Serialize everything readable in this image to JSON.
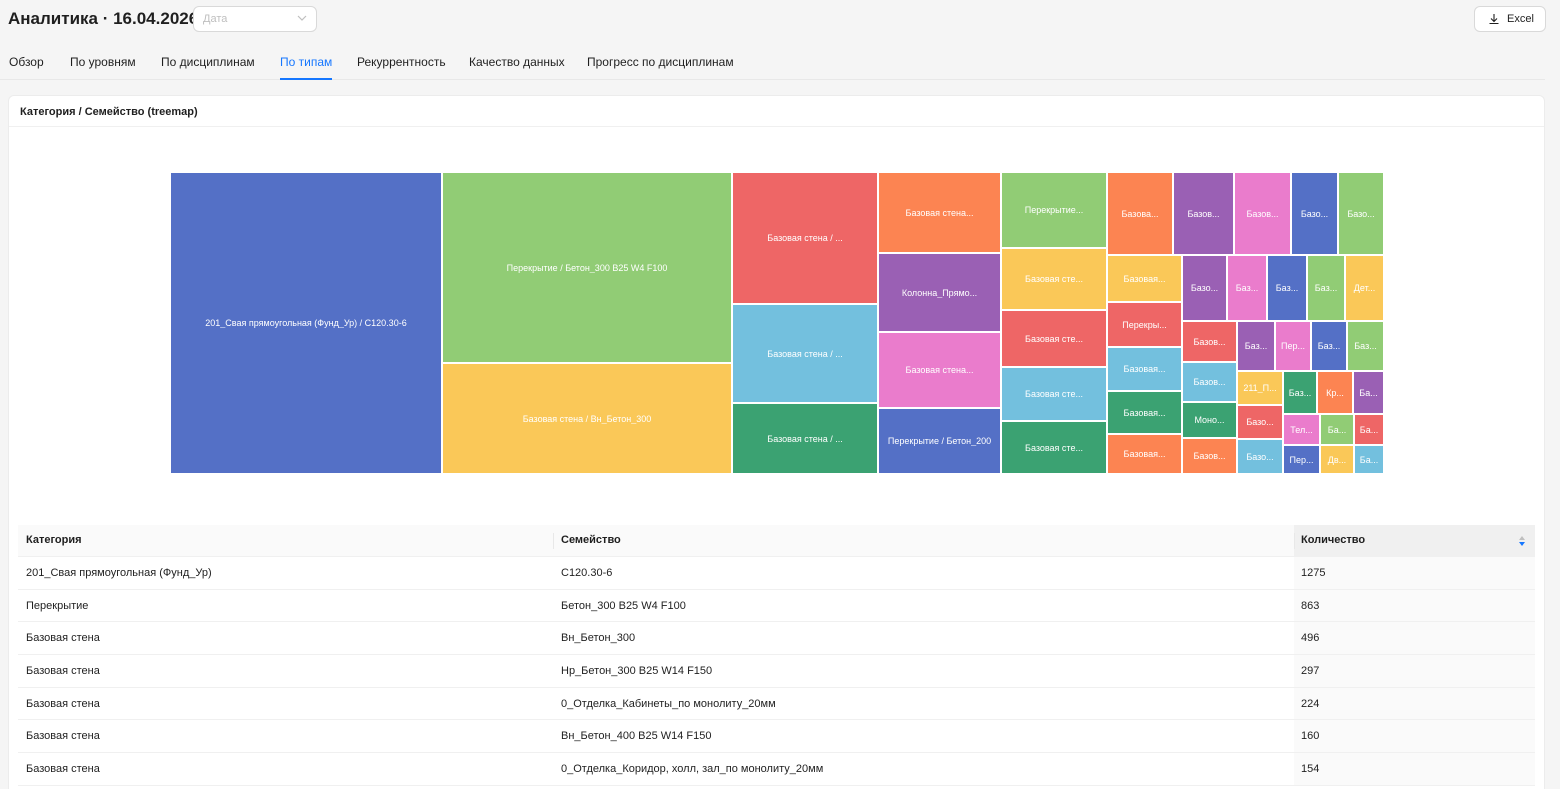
{
  "header": {
    "title": "Аналитика · 16.04.2026",
    "date_placeholder": "Дата",
    "export_label": "Excel"
  },
  "tabs": [
    {
      "label": "Обзор",
      "active": false
    },
    {
      "label": "По уровням",
      "active": false
    },
    {
      "label": "По дисциплинам",
      "active": false
    },
    {
      "label": "По типам",
      "active": true
    },
    {
      "label": "Рекуррентность",
      "active": false
    },
    {
      "label": "Качество данных",
      "active": false
    },
    {
      "label": "Прогресс по дисциплинам",
      "active": false
    }
  ],
  "card": {
    "title": "Категория / Семейство (treemap)"
  },
  "treemap": {
    "tiles": [
      {
        "label": "201_Свая прямоугольная (Фунд_Ур) / С120.30-6",
        "color": "#5470c6"
      },
      {
        "label": "Перекрытие / Бетон_300 B25 W4 F100",
        "color": "#91cc75"
      },
      {
        "label": "Базовая стена / Вн_Бетон_300",
        "color": "#fac858"
      },
      {
        "label": "Базовая стена / ...",
        "color": "#ee6666"
      },
      {
        "label": "Базовая стена / ...",
        "color": "#73c0de"
      },
      {
        "label": "Базовая стена / ...",
        "color": "#3ba272"
      },
      {
        "label": "Базовая стена...",
        "color": "#fc8452"
      },
      {
        "label": "Колонна_Прямо...",
        "color": "#9a60b4"
      },
      {
        "label": "Базовая стена...",
        "color": "#ea7ccc"
      },
      {
        "label": "Перекрытие / Бетон_200",
        "color": "#5470c6"
      },
      {
        "label": "Перекрытие...",
        "color": "#91cc75"
      },
      {
        "label": "Базовая сте...",
        "color": "#fac858"
      },
      {
        "label": "Базовая сте...",
        "color": "#ee6666"
      },
      {
        "label": "Базовая сте...",
        "color": "#73c0de"
      },
      {
        "label": "Базовая сте...",
        "color": "#3ba272"
      },
      {
        "label": "Базова...",
        "color": "#fc8452"
      },
      {
        "label": "Базовая...",
        "color": "#fac858"
      },
      {
        "label": "Перекры...",
        "color": "#ee6666"
      },
      {
        "label": "Базовая...",
        "color": "#73c0de"
      },
      {
        "label": "Базовая...",
        "color": "#3ba272"
      },
      {
        "label": "Базовая...",
        "color": "#fc8452"
      },
      {
        "label": "Базов...",
        "color": "#9a60b4"
      },
      {
        "label": "Базов...",
        "color": "#ea7ccc"
      },
      {
        "label": "Базо...",
        "color": "#5470c6"
      },
      {
        "label": "Базо...",
        "color": "#91cc75"
      },
      {
        "label": "Базо...",
        "color": "#9a60b4"
      },
      {
        "label": "Баз...",
        "color": "#ea7ccc"
      },
      {
        "label": "Баз...",
        "color": "#5470c6"
      },
      {
        "label": "Баз...",
        "color": "#91cc75"
      },
      {
        "label": "Дет...",
        "color": "#fac858"
      },
      {
        "label": "Базов...",
        "color": "#ee6666"
      },
      {
        "label": "Баз...",
        "color": "#9a60b4"
      },
      {
        "label": "Пер...",
        "color": "#ea7ccc"
      },
      {
        "label": "Баз...",
        "color": "#5470c6"
      },
      {
        "label": "Баз...",
        "color": "#91cc75"
      },
      {
        "label": "Базов...",
        "color": "#73c0de"
      },
      {
        "label": "211_П...",
        "color": "#fac858"
      },
      {
        "label": "Баз...",
        "color": "#3ba272"
      },
      {
        "label": "Кр...",
        "color": "#fc8452"
      },
      {
        "label": "Ба...",
        "color": "#9a60b4"
      },
      {
        "label": "Моно...",
        "color": "#3ba272"
      },
      {
        "label": "Базо...",
        "color": "#ee6666"
      },
      {
        "label": "Тел...",
        "color": "#ea7ccc"
      },
      {
        "label": "Ба...",
        "color": "#91cc75"
      },
      {
        "label": "Ба...",
        "color": "#ee6666"
      },
      {
        "label": "Базов...",
        "color": "#fc8452"
      },
      {
        "label": "Базо...",
        "color": "#73c0de"
      },
      {
        "label": "Пер...",
        "color": "#5470c6"
      },
      {
        "label": "Дв...",
        "color": "#fac858"
      },
      {
        "label": "Ба...",
        "color": "#73c0de"
      }
    ]
  },
  "table": {
    "columns": [
      "Категория",
      "Семейство",
      "Количество"
    ],
    "rows": [
      [
        "201_Свая прямоугольная (Фунд_Ур)",
        "С120.30-6",
        "1275"
      ],
      [
        "Перекрытие",
        "Бетон_300 B25 W4 F100",
        "863"
      ],
      [
        "Базовая стена",
        "Вн_Бетон_300",
        "496"
      ],
      [
        "Базовая стена",
        "Нр_Бетон_300 B25 W14 F150",
        "297"
      ],
      [
        "Базовая стена",
        "0_Отделка_Кабинеты_по монолиту_20мм",
        "224"
      ],
      [
        "Базовая стена",
        "Вн_Бетон_400 B25 W14 F150",
        "160"
      ],
      [
        "Базовая стена",
        "0_Отделка_Коридор, холл, зал_по монолиту_20мм",
        "154"
      ]
    ]
  }
}
